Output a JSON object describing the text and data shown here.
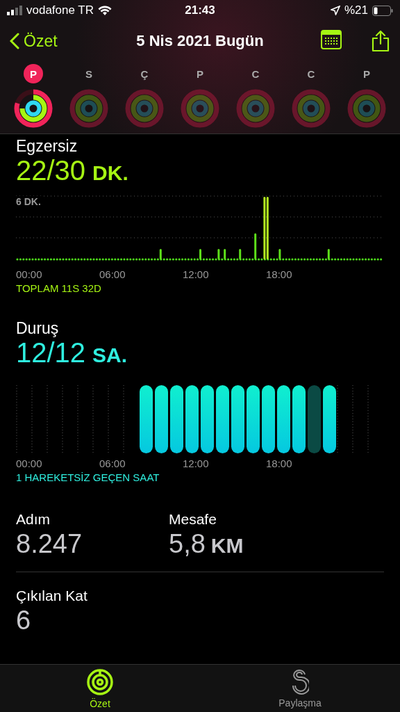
{
  "status_bar": {
    "carrier": "vodafone TR",
    "time": "21:43",
    "battery": "%21"
  },
  "nav": {
    "back": "Özet",
    "title": "5 Nis 2021 Bugün"
  },
  "week": [
    {
      "day": "P",
      "selected": true
    },
    {
      "day": "S",
      "selected": false
    },
    {
      "day": "Ç",
      "selected": false
    },
    {
      "day": "P",
      "selected": false
    },
    {
      "day": "C",
      "selected": false
    },
    {
      "day": "C",
      "selected": false
    },
    {
      "day": "P",
      "selected": false
    }
  ],
  "exercise": {
    "title": "Egzersiz",
    "value": "22/30",
    "unit": "DK.",
    "y_label": "6 DK.",
    "x_labels": [
      "00:00",
      "06:00",
      "12:00",
      "18:00"
    ],
    "footer": "TOPLAM 11S 32D"
  },
  "stand": {
    "title": "Duruş",
    "value": "12/12",
    "unit": "SA.",
    "hours": [
      {
        "achieved": true
      },
      {
        "achieved": true
      },
      {
        "achieved": true
      },
      {
        "achieved": true
      },
      {
        "achieved": true
      },
      {
        "achieved": true
      },
      {
        "achieved": true
      },
      {
        "achieved": true
      },
      {
        "achieved": true
      },
      {
        "achieved": true
      },
      {
        "achieved": true
      },
      {
        "achieved": false
      },
      {
        "achieved": true
      }
    ],
    "x_labels": [
      "00:00",
      "06:00",
      "12:00",
      "18:00"
    ],
    "footer": "1 HAREKETSİZ GEÇEN SAAT"
  },
  "stats": [
    {
      "label": "Adım",
      "value": "8.247"
    },
    {
      "label": "Mesafe",
      "value": "5,8",
      "unit": "KM"
    }
  ],
  "floors": {
    "label": "Çıkılan Kat",
    "value": "6"
  },
  "tabs": [
    {
      "label": "Özet",
      "selected": true
    },
    {
      "label": "Paylaşma",
      "selected": false
    }
  ]
}
